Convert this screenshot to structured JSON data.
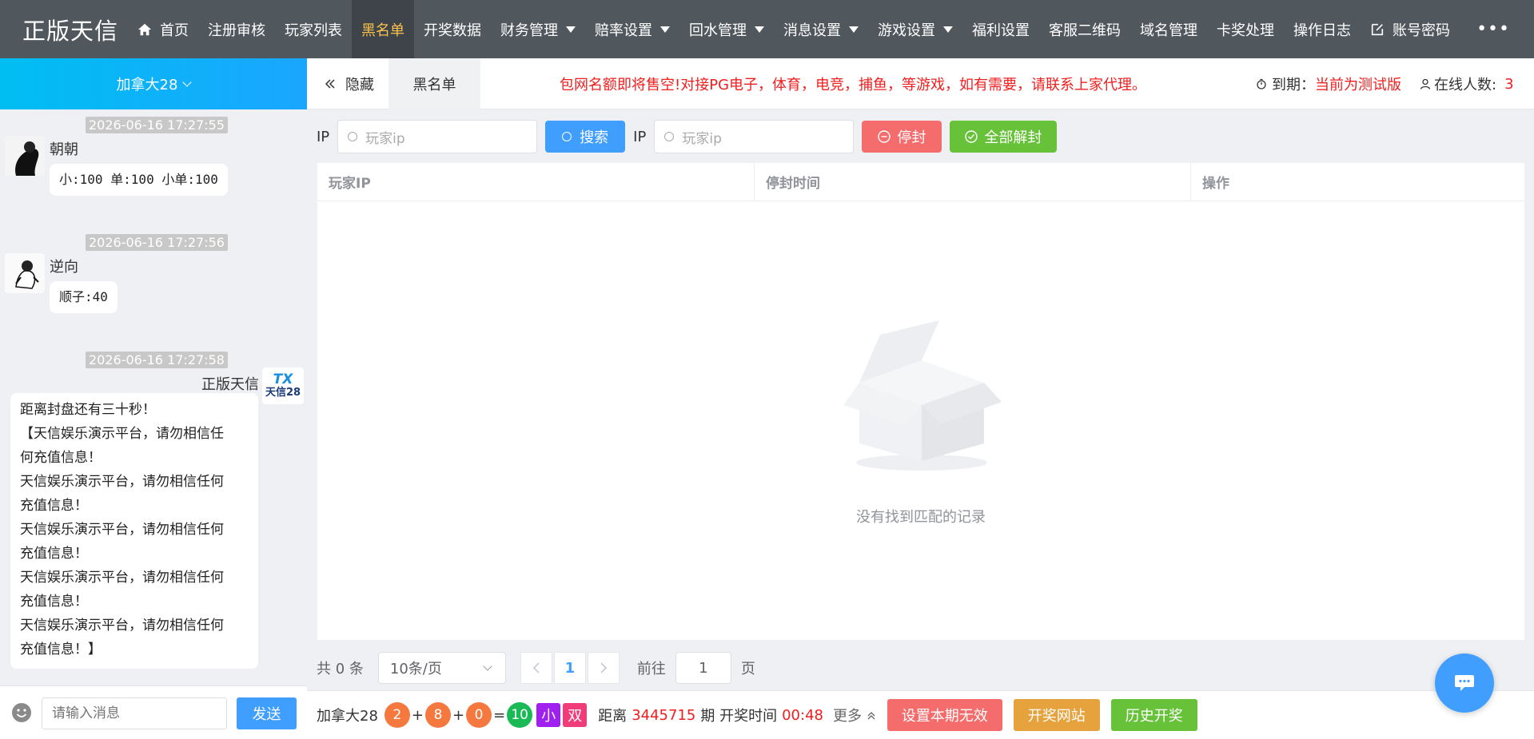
{
  "app": {
    "logo": "正版天信"
  },
  "nav": {
    "items": [
      {
        "label": "首页",
        "icon": "home-icon",
        "dropdown": false,
        "active": false
      },
      {
        "label": "注册审核",
        "dropdown": false,
        "active": false
      },
      {
        "label": "玩家列表",
        "dropdown": false,
        "active": false
      },
      {
        "label": "黑名单",
        "dropdown": false,
        "active": true
      },
      {
        "label": "开奖数据",
        "dropdown": false,
        "active": false
      },
      {
        "label": "财务管理",
        "dropdown": true,
        "active": false
      },
      {
        "label": "赔率设置",
        "dropdown": true,
        "active": false
      },
      {
        "label": "回水管理",
        "dropdown": true,
        "active": false
      },
      {
        "label": "消息设置",
        "dropdown": true,
        "active": false
      },
      {
        "label": "游戏设置",
        "dropdown": true,
        "active": false
      },
      {
        "label": "福利设置",
        "dropdown": false,
        "active": false
      },
      {
        "label": "客服二维码",
        "dropdown": false,
        "active": false
      },
      {
        "label": "域名管理",
        "dropdown": false,
        "active": false
      },
      {
        "label": "卡奖处理",
        "dropdown": false,
        "active": false
      },
      {
        "label": "操作日志",
        "dropdown": false,
        "active": false
      },
      {
        "label": "账号密码",
        "icon": "edit-icon",
        "dropdown": false,
        "active": false
      }
    ],
    "more": "•••"
  },
  "sidebar": {
    "room": "加拿大28",
    "messages": [
      {
        "time": "2026-06-16 17:27:55",
        "user": "朝朝",
        "text": "小:100 单:100 小单:100",
        "side": "left"
      },
      {
        "time": "2026-06-16 17:27:56",
        "user": "逆向",
        "text": "顺子:40",
        "side": "left"
      },
      {
        "time": "2026-06-16 17:27:58",
        "user": "正版天信",
        "side": "right",
        "lines": [
          "距离封盘还有三十秒！",
          "【天信娱乐演示平台，请勿相信任",
          "何充值信息！",
          "天信娱乐演示平台，请勿相信任何",
          "充值信息！",
          "天信娱乐演示平台，请勿相信任何",
          "充值信息！",
          "天信娱乐演示平台，请勿相信任何",
          "充值信息！",
          "天信娱乐演示平台，请勿相信任何",
          "充值信息！】"
        ]
      }
    ],
    "bot_avatar_text": "天信28",
    "bot_avatar_mark": "TX",
    "input_placeholder": "请输入消息",
    "send_label": "发送"
  },
  "tabbar": {
    "hide_label": "隐藏",
    "tab_label": "黑名单",
    "notice": "包网名额即将售空!对接PG电子，体育，电竞，捕鱼，等游戏，如有需要，请联系上家代理。",
    "expire_label": "到期：",
    "expire_value": "当前为测试版",
    "online_label": "在线人数:",
    "online_value": "3"
  },
  "toolbar": {
    "ip_label_1": "IP",
    "search_placeholder_1": "玩家ip",
    "search_button": "搜索",
    "ip_label_2": "IP",
    "search_placeholder_2": "玩家ip",
    "ban_button": "停封",
    "unban_all_button": "全部解封"
  },
  "table": {
    "columns": [
      "玩家IP",
      "停封时间",
      "操作"
    ],
    "rows": [],
    "empty_text": "没有找到匹配的记录"
  },
  "pager": {
    "total": "共 0 条",
    "page_size": "10条/页",
    "current_page": "1",
    "goto_label": "前往",
    "goto_value": "1",
    "page_suffix": "页"
  },
  "bottombar": {
    "game": "加拿大28",
    "ball1": "2",
    "ball2": "8",
    "ball3": "0",
    "sum": "10",
    "size": "小",
    "parity": "双",
    "plus": "+",
    "equals": "=",
    "period_prefix": "距离",
    "period": "3445715",
    "period_suffix": "期 开奖时间",
    "countdown": "00:48",
    "more": "更多",
    "btn_invalid": "设置本期无效",
    "btn_site": "开奖网站",
    "btn_history": "历史开奖"
  },
  "colors": {
    "topbar": "#50585e",
    "active": "#f7c14b",
    "primary": "#409eff",
    "danger": "#f56c6c",
    "success": "#67c23a",
    "orange": "#e6a23c",
    "ball_orange": "#f5793f",
    "ball_green": "#19b955",
    "badge_purple": "#a020f0",
    "badge_pink": "#f03c78"
  }
}
